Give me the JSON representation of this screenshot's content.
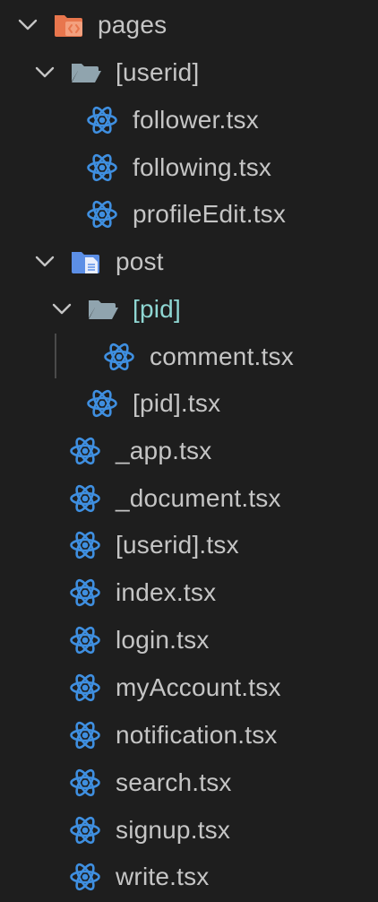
{
  "explorer": {
    "items": [
      {
        "label": "pages",
        "icon": "folder-pages-open-icon",
        "expanded": true
      },
      {
        "label": "[userid]",
        "icon": "folder-open-icon",
        "expanded": true
      },
      {
        "label": "follower.tsx",
        "icon": "react-icon"
      },
      {
        "label": "following.tsx",
        "icon": "react-icon"
      },
      {
        "label": "profileEdit.tsx",
        "icon": "react-icon"
      },
      {
        "label": "post",
        "icon": "folder-docs-icon",
        "expanded": true
      },
      {
        "label": "[pid]",
        "icon": "folder-open-icon",
        "expanded": true
      },
      {
        "label": "comment.tsx",
        "icon": "react-icon"
      },
      {
        "label": "[pid].tsx",
        "icon": "react-icon"
      },
      {
        "label": "_app.tsx",
        "icon": "react-icon"
      },
      {
        "label": "_document.tsx",
        "icon": "react-icon"
      },
      {
        "label": "[userid].tsx",
        "icon": "react-icon"
      },
      {
        "label": "index.tsx",
        "icon": "react-icon"
      },
      {
        "label": "login.tsx",
        "icon": "react-icon"
      },
      {
        "label": "myAccount.tsx",
        "icon": "react-icon"
      },
      {
        "label": "notification.tsx",
        "icon": "react-icon"
      },
      {
        "label": "search.tsx",
        "icon": "react-icon"
      },
      {
        "label": "signup.tsx",
        "icon": "react-icon"
      },
      {
        "label": "write.tsx",
        "icon": "react-icon"
      }
    ]
  },
  "colors": {
    "background": "#1e1e1e",
    "text": "#c5c5c5",
    "highlight_text": "#8fd7d3",
    "react_icon": "#3f8fe0",
    "folder_pages": "#e8764d",
    "folder_plain": "#90a4ae",
    "folder_docs": "#5c8fe6"
  }
}
